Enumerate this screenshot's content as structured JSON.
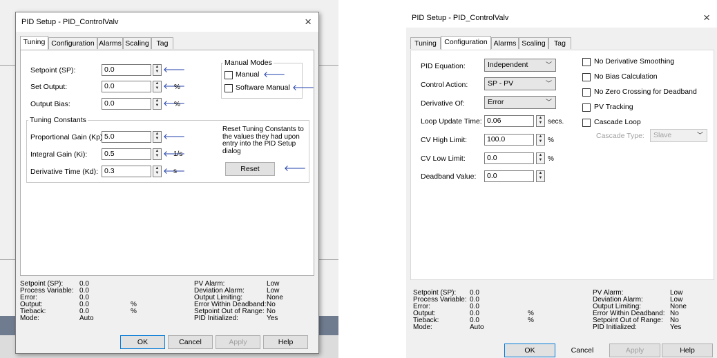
{
  "dialog_title": "PID Setup - PID_ControlValv",
  "close_glyph": "×",
  "tabs": [
    "Tuning",
    "Configuration",
    "Alarms",
    "Scaling",
    "Tag"
  ],
  "tuning": {
    "setpoint_label": "Setpoint (SP):",
    "setpoint_value": "0.0",
    "set_output_label": "Set Output:",
    "set_output_value": "0.0",
    "set_output_unit": "%",
    "output_bias_label": "Output Bias:",
    "output_bias_value": "0.0",
    "output_bias_unit": "%",
    "manual_modes_title": "Manual Modes",
    "manual_label": "Manual",
    "software_manual_label": "Software Manual",
    "tuning_constants_title": "Tuning Constants",
    "kp_label": "Proportional Gain (Kp):",
    "kp_value": "5.0",
    "ki_label": "Integral Gain (Ki):",
    "ki_value": "0.5",
    "ki_unit": "1/s",
    "kd_label": "Derivative Time (Kd):",
    "kd_value": "0.3",
    "kd_unit": "s",
    "reset_text": "Reset Tuning Constants to the values they had upon entry into the PID Setup dialog",
    "reset_button": "Reset"
  },
  "configuration": {
    "pid_equation_label": "PID Equation:",
    "pid_equation_value": "Independent",
    "control_action_label": "Control Action:",
    "control_action_value": "SP - PV",
    "derivative_of_label": "Derivative Of:",
    "derivative_of_value": "Error",
    "loop_update_label": "Loop Update Time:",
    "loop_update_value": "0.06",
    "loop_update_unit": "secs.",
    "cv_high_label": "CV High Limit:",
    "cv_high_value": "100.0",
    "cv_high_unit": "%",
    "cv_low_label": "CV Low Limit:",
    "cv_low_value": "0.0",
    "cv_low_unit": "%",
    "deadband_label": "Deadband Value:",
    "deadband_value": "0.0",
    "no_derivative_smoothing": "No Derivative Smoothing",
    "no_bias_calculation": "No Bias Calculation",
    "no_zero_crossing": "No Zero Crossing for Deadband",
    "pv_tracking": "PV Tracking",
    "cascade_loop": "Cascade Loop",
    "cascade_type_label": "Cascade Type:",
    "cascade_type_value": "Slave"
  },
  "status": {
    "sp_label": "Setpoint (SP):",
    "sp_value": "0.0",
    "pv_label": "Process Variable:",
    "pv_value": "0.0",
    "error_label": "Error:",
    "error_value": "0.0",
    "output_label": "Output:",
    "output_value": "0.0",
    "output_unit": "%",
    "tieback_label": "Tieback:",
    "tieback_value": "0.0",
    "tieback_unit": "%",
    "mode_label": "Mode:",
    "mode_value": "Auto",
    "pv_alarm_label": "PV Alarm:",
    "pv_alarm_value": "Low",
    "dev_alarm_label": "Deviation Alarm:",
    "dev_alarm_value": "Low",
    "out_limiting_label": "Output Limiting:",
    "out_limiting_value": "None",
    "err_deadband_label": "Error Within Deadband:",
    "err_deadband_value": "No",
    "sp_range_label": "Setpoint Out of Range:",
    "sp_range_value": "No",
    "pid_init_label": "PID Initialized:",
    "pid_init_value": "Yes"
  },
  "buttons": {
    "ok": "OK",
    "cancel": "Cancel",
    "apply": "Apply",
    "help": "Help"
  },
  "colors": {
    "arrow": "#1f3ea8",
    "accent": "#0078d7"
  }
}
